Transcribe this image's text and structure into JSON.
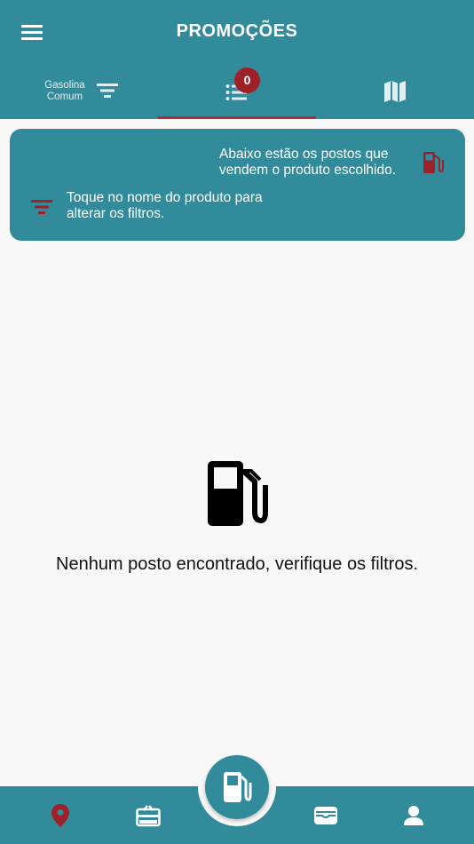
{
  "header": {
    "title": "PROMOÇÕES",
    "menu_icon": "hamburger-menu-icon"
  },
  "tabs": {
    "fuel_filter": {
      "label": "Gasolina Comum",
      "icon": "filter-icon"
    },
    "list": {
      "icon": "list-icon",
      "badge": "0",
      "selected": true
    },
    "map": {
      "icon": "map-icon"
    }
  },
  "info_card": {
    "text1": "Abaixo estão os postos que vendem o produto escolhido.",
    "text2": "Toque no nome do produto para alterar os filtros.",
    "icon1": "fuel-pump-icon",
    "icon2": "filter-icon"
  },
  "empty_state": {
    "icon": "fuel-pump-icon",
    "message": "Nenhum posto encontrado, verifique os filtros."
  },
  "bottom_nav": {
    "items": [
      {
        "icon": "map-pin-icon",
        "active": true
      },
      {
        "icon": "gift-card-icon"
      },
      {
        "icon": "wallet-icon"
      },
      {
        "icon": "profile-icon"
      }
    ],
    "center_button": {
      "icon": "fuel-pump-icon"
    }
  },
  "colors": {
    "primary": "#318b9b",
    "accent": "#9d2127",
    "background": "#f8f8f8"
  }
}
